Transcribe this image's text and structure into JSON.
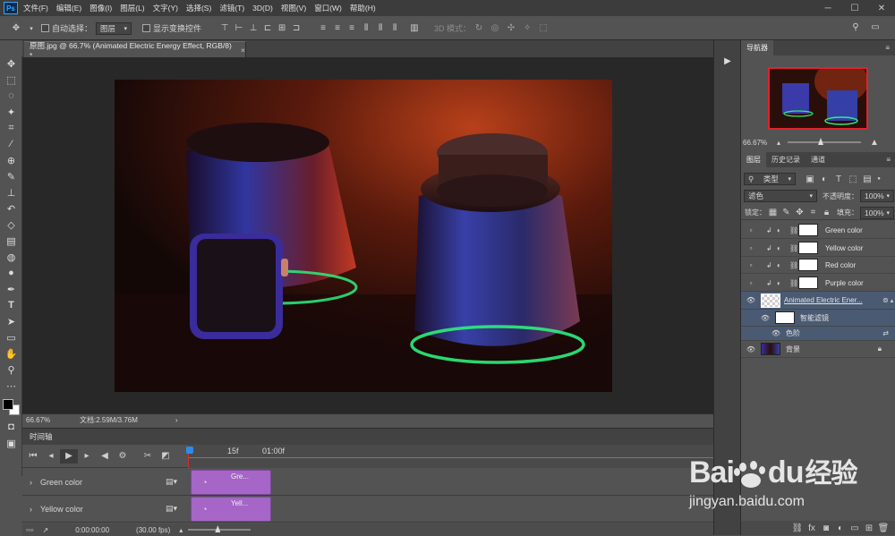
{
  "menu": {
    "logo": "Ps",
    "items": [
      "文件(F)",
      "编辑(E)",
      "图像(I)",
      "图层(L)",
      "文字(Y)",
      "选择(S)",
      "滤镜(T)",
      "3D(D)",
      "视图(V)",
      "窗口(W)",
      "帮助(H)"
    ]
  },
  "options": {
    "auto_select_label": "自动选择：",
    "auto_select_value": "图层",
    "show_transform_label": "显示变换控件",
    "mode_3d_label": "3D 模式："
  },
  "document": {
    "tab_title": "原图.jpg @ 66.7% (Animated Electric Energy Effect, RGB/8) *",
    "zoom": "66.67%",
    "doc_size": "文档:2.59M/3.76M"
  },
  "timeline": {
    "title": "时间轴",
    "ruler_15f": "15f",
    "ruler_1s": "01:00f",
    "tracks": [
      {
        "name": "Green color",
        "clip": "Gre..."
      },
      {
        "name": "Yellow color",
        "clip": "Yell..."
      }
    ],
    "timecode": "0:00:00:00",
    "fps": "(30.00 fps)"
  },
  "navigator": {
    "title": "导航器",
    "zoom": "66.67%"
  },
  "layers_panel": {
    "tabs": [
      "图层",
      "历史记录",
      "通道"
    ],
    "filter_kind": "类型",
    "blend_mode": "滤色",
    "opacity_label": "不透明度：",
    "opacity": "100%",
    "lock_label": "锁定：",
    "fill_label": "填充：",
    "fill": "100%",
    "layers": [
      {
        "name": "Green color"
      },
      {
        "name": "Yellow color"
      },
      {
        "name": "Red color"
      },
      {
        "name": "Purple color"
      },
      {
        "name": "Animated Electric Ener..."
      },
      {
        "name": "智能滤镜"
      },
      {
        "name": "色阶"
      },
      {
        "name": "背景"
      }
    ]
  },
  "watermark": {
    "brand": "Bai",
    "brand2": "du",
    "cn": "经验",
    "url": "jingyan.baidu.com"
  }
}
